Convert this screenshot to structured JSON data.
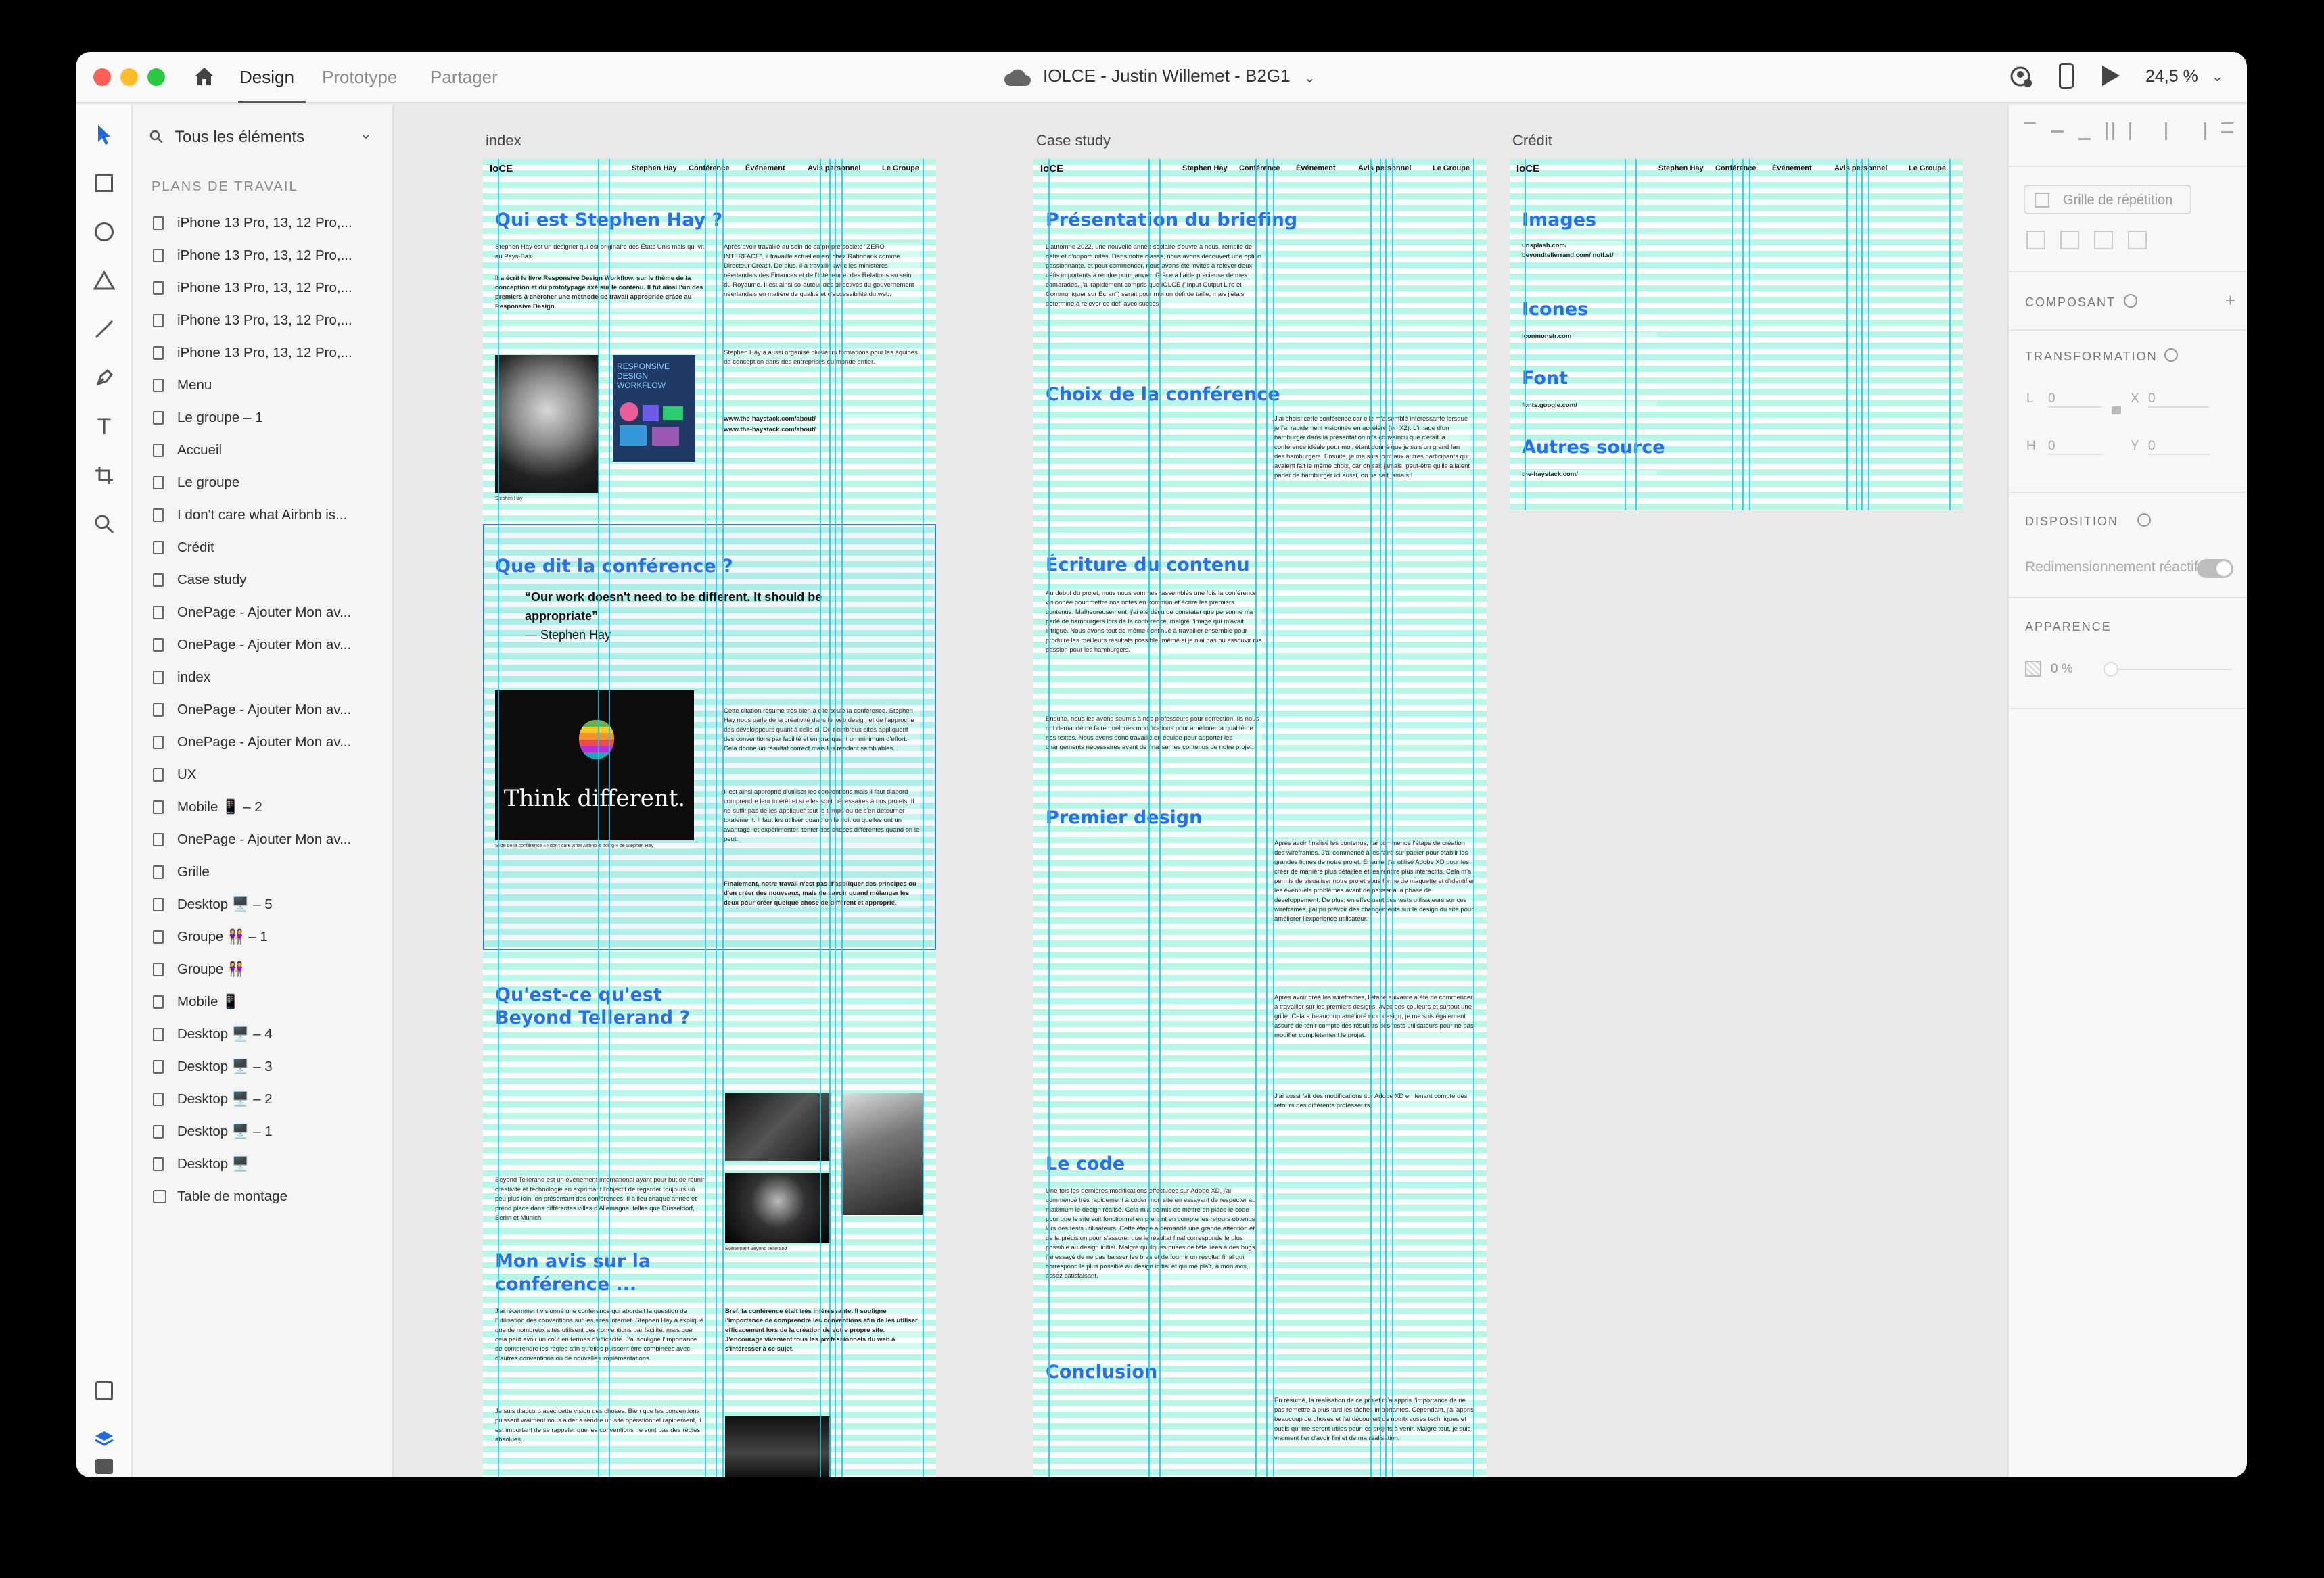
{
  "titlebar": {
    "tabs": [
      "Design",
      "Prototype",
      "Partager"
    ],
    "doc_title": "IOLCE - Justin Willemet - B2G1",
    "zoom": "24,5 %"
  },
  "layers": {
    "search_placeholder": "Tous les éléments",
    "section_title": "PLANS DE TRAVAIL",
    "items": [
      "iPhone 13 Pro, 13, 12 Pro,...",
      "iPhone 13 Pro, 13, 12 Pro,...",
      "iPhone 13 Pro, 13, 12 Pro,...",
      "iPhone 13 Pro, 13, 12 Pro,...",
      "iPhone 13 Pro, 13, 12 Pro,...",
      "Menu",
      "Le groupe – 1",
      "Accueil",
      "Le groupe",
      "I don't care what Airbnb is...",
      "Crédit",
      "Case study",
      "OnePage - Ajouter Mon av...",
      "OnePage - Ajouter Mon av...",
      "index",
      "OnePage - Ajouter Mon av...",
      "OnePage - Ajouter Mon av...",
      "UX",
      "Mobile 📱 – 2",
      "OnePage - Ajouter Mon av...",
      "Grille",
      "Desktop 🖥️ – 5",
      "Groupe 👭 – 1",
      "Groupe 👭",
      "Mobile 📱",
      "Desktop 🖥️ – 4",
      "Desktop 🖥️ – 3",
      "Desktop 🖥️ – 2",
      "Desktop 🖥️ – 1",
      "Desktop 🖥️",
      "Table de montage"
    ]
  },
  "canvas": {
    "nav": {
      "logo": "IoCE",
      "links": [
        "Stephen Hay",
        "Conférence",
        "Événement",
        "Avis personnel",
        "Le Groupe"
      ]
    },
    "index": {
      "label": "index",
      "h_qui": "Qui est Stephen Hay ?",
      "p_qui_1": "Stephen Hay est un designer qui est originaire des États Unis mais qui vit au Pays-Bas.",
      "p_qui_2": "Il a écrit le livre Responsive Design Workflow, sur le thème de la conception et du prototypage axé sur le contenu. Il fut ainsi l'un des premiers à chercher une méthode de travail appropriée grâce au Responsive Design.",
      "p_qui_3": "Après avoir travaillé au sein de sa propre société \"ZERO INTERFACE\", il travaille actuellement chez Rabobank comme Directeur Créatif. De plus, il a travaillé avec les ministères néerlandais des Finances et de l'Intérieur et des Relations au sein du Royaume. Il est ainsi co-auteur des directives du gouvernement néerlandais en matière de qualité et d'accessibilité du web.",
      "p_qui_4": "Stephen Hay a aussi organisé plusieurs formations pour les équipes de conception dans des entreprises du monde entier.",
      "links": "www.the-haystack.com/about/",
      "book_title": "RESPONSIVE DESIGN WORKFLOW",
      "caption_hay": "Stephen Hay",
      "h_conf": "Que dit la conférence ?",
      "quote": "“Our work doesn't need to be different. It should be appropriate”",
      "quote_author": "— Stephen Hay",
      "think_text": "Think different.",
      "caption_think": "Slide de la conférence « I don't care what Airbnb is doing » de Stephen Hay",
      "p_conf_1": "Cette citation résume très bien à elle seule la conférence. Stephen Hay nous parle de la créativité dans le web design et de l'approche des développeurs quant à celle-ci. De nombreux sites appliquent des conventions par facilité et en pratiquant un minimum d'effort. Cela donne un résultat correct mais les rendant semblables.",
      "p_conf_2": "Il est ainsi approprié d'utiliser les conventions mais il faut d'abord comprendre leur intérêt et si elles sont nécessaires à nos projets. Il ne suffit pas de les appliquer tout le temps ou de s'en détourner totalement. Il faut les utiliser quand on le doit ou quelles ont un avantage, et expérimenter, tenter des choses différentes quand on le peut.",
      "p_conf_3": "Finalement, notre travail n'est pas d'appliquer des principes ou d'en créer des nouveaux, mais de savoir quand mélanger les deux pour créer quelque chose de différent et approprié.",
      "h_bt": "Qu'est-ce qu'est Beyond Tellerand ?",
      "p_bt": "Beyond Tellerand est un évènement international ayant pour but de réunir créativité et technologie en exprimant l'objectif de regarder toujours un peu plus loin, en présentant des conférences. Il a lieu chaque année et prend place dans différentes villes d'Allemagne, telles que Düsseldorf, Berlin et Munich.",
      "caption_bt": "Événement Beyond Tellerand",
      "h_avis": "Mon avis sur la conférence ...",
      "p_avis_1": "J'ai récemment visionné une conférence qui abordait la question de l'utilisation des conventions sur les sites internet. Stephen Hay a expliqué que de nombreux sites utilisent ces conventions par facilité, mais que cela peut avoir un coût en termes d'efficacité. J'ai souligné l'importance de comprendre les règles afin qu'elles puissent être combinées avec d'autres conventions ou de nouvelles implémentations.",
      "p_avis_2": "Je suis d'accord avec cette vision des choses. Bien que les conventions puissent vraiment nous aider à rendre un site opérationnel rapidement, il est important de se rappeler que les conventions ne sont pas des règles absolues.",
      "p_avis_3": "Bref, la conférence était très intéressante. Il souligne l'importance de comprendre les conventions afin de les utiliser efficacement lors de la création de votre propre site. J'encourage vivement tous les professionnels du web à s'intéresser à ce sujet."
    },
    "case": {
      "label": "Case study",
      "h1": "Présentation du briefing",
      "p1": "L'automne 2022, une nouvelle année scolaire s'ouvre à nous, remplie de défis et d'opportunités. Dans notre classe, nous avons découvert une option passionnante, et pour commencer, nous avons été invités à relever deux défis importants à rendre pour janvier. Grâce à l'aide précieuse de mes camarades, j'ai rapidement compris que IOLCE (\"Input Output Lire et Communiquer sur Écran\") serait pour moi un défi de taille, mais j'étais déterminé à relever ce défi avec succès.",
      "h2": "Choix de la conférence",
      "p2": "J'ai choisi cette conférence car elle m'a semblé intéressante lorsque je l'ai rapidement visionnée en accéléré (en X2). L'image d'un hamburger dans la présentation m'a convaincu que c'était la conférence idéale pour moi, étant donné que je suis un grand fan des hamburgers. Ensuite, je me suis joint aux autres participants qui avaient fait le même choix, car on sait jamais, peut-être qu'ils allaient parler de hamburger ici aussi, on ne sait jamais !",
      "h3": "Écriture du contenu",
      "p3": "Au début du projet, nous nous sommes rassemblés une fois la conférence visionnée pour mettre nos notes en commun et écrire les premiers contenus. Malheureusement, j'ai été déçu de constater que personne n'a parlé de hamburgers lors de la conférence, malgré l'image qui m'avait intrigué. Nous avons tout de même continué à travailler ensemble pour produire les meilleurs résultats possible, même si je n'ai pas pu assouvir ma passion pour les hamburgers.",
      "p3b": "Ensuite, nous les avons soumis à nos professeurs pour correction. Ils nous ont demandé de faire quelques modifications pour améliorer la qualité de nos textes. Nous avons donc travaillé en équipe pour apporter les changements nécessaires avant de finaliser les contenus de notre projet.",
      "h4": "Premier design",
      "p4": "Après avoir finalisé les contenus, j'ai commencé l'étape de création des wireframes. J'ai commencé à les faire sur papier pour établir les grandes lignes de notre projet. Ensuite, j'ai utilisé Adobe XD pour les créer de manière plus détaillée et les rendre plus interactifs. Cela m'a permis de visualiser notre projet sous forme de maquette et d'identifier les éventuels problèmes avant de passer à la phase de développement. De plus, en effectuant des tests utilisateurs sur ces wireframes, j'ai pu prévoir des changements sur le design du site pour améliorer l'expérience utilisateur.",
      "p4b": "Après avoir créé les wireframes, l'étape suivante a été de commencer à travailler sur les premiers designs, avec des couleurs et surtout une grille. Cela a beaucoup amélioré mon design, je me suis également assuré de tenir compte des résultats des tests utilisateurs pour ne pas modifier complètement le projet.",
      "p4c": "J'ai aussi fait des modifications sur Adobe XD en tenant compte des retours des différents professeurs.",
      "h5": "Le code",
      "p5": "Une fois les dernières modifications effectuées sur Adobe XD, j'ai commencé très rapidement à coder mon site en essayant de respecter au maximum le design réalisé. Cela m'a permis de mettre en place le code pour que le site soit fonctionnel en prenant en compte les retours obtenus lors des tests utilisateurs. Cette étape a demandé une grande attention et de la précision pour s'assurer que le résultat final corresponde le plus possible au design initial. Malgré quelques prises de tête liées à des bugs, j'ai essayé de ne pas baisser les bras et de fournir un résultat final qui correspond le plus possible au design initial et qui me plaît, à mon avis, assez satisfaisant.",
      "h6": "Conclusion",
      "p6": "En résumé, la réalisation de ce projet m'a appris l'importance de ne pas remettre à plus tard les tâches importantes. Cependant, j'ai appris beaucoup de choses et j'ai découvert de nombreuses techniques et outils qui me seront utiles pour les projets à venir. Malgré tout, je suis vraiment fier d'avoir fini et de ma réalisation."
    },
    "credit": {
      "label": "Crédit",
      "h_images": "Images",
      "images_src": "unsplash.com/ beyondtellerrand.com/ notl.st/",
      "h_icones": "Icones",
      "icones_src": "iconmonstr.com",
      "h_font": "Font",
      "font_src": "fonts.google.com/",
      "h_autres": "Autres source",
      "autres_src": "the-haystack.com/"
    }
  },
  "props": {
    "repeat_grid": "Grille de répétition",
    "component": "COMPOSANT",
    "transform": "TRANSFORMATION",
    "w_label": "L",
    "w_val": "0",
    "x_label": "X",
    "x_val": "0",
    "h_label": "H",
    "h_val": "0",
    "y_label": "Y",
    "y_val": "0",
    "layout": "DISPOSITION",
    "responsive": "Redimensionnement réactif",
    "appearance": "APPARENCE",
    "opacity": "0 %"
  },
  "colors": {
    "accent": "#2970e6",
    "grid_col": "#22c3e6",
    "grid_row": "#b8f7e8",
    "close": "#fe5f57",
    "minimize": "#febc2e",
    "maximize": "#28c840"
  }
}
